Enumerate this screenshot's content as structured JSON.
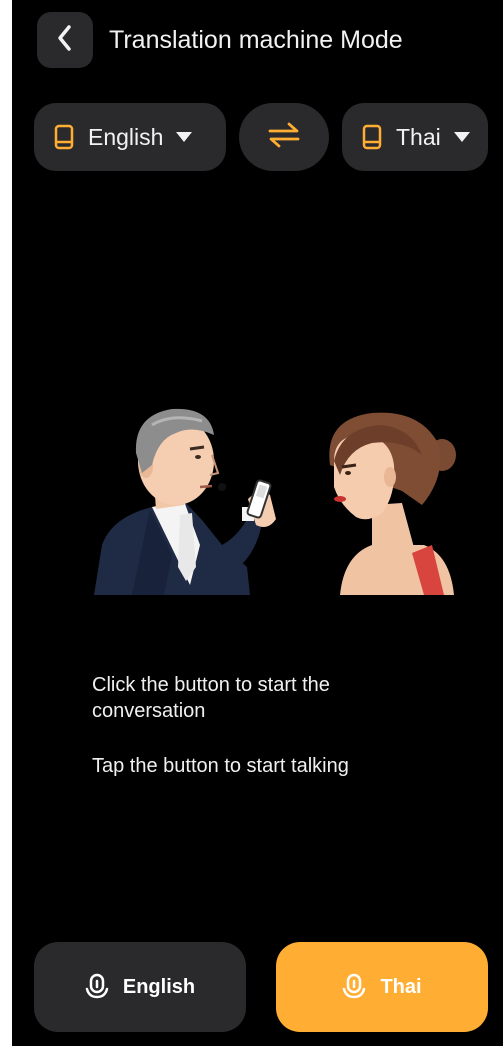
{
  "colors": {
    "background": "#000000",
    "surface": "#2a2a2d",
    "accent": "#ffad33",
    "text": "#f2f2f2"
  },
  "header": {
    "back_icon": "chevron-left-icon",
    "title": "Translation machine Mode"
  },
  "language_bar": {
    "source": {
      "icon": "phone-icon",
      "label": "English",
      "dropdown_icon": "caret-down-icon"
    },
    "swap_icon": "swap-arrows-icon",
    "target": {
      "icon": "phone-icon",
      "label": "Thai",
      "dropdown_icon": "caret-down-icon"
    }
  },
  "illustration": {
    "description_icon": "conversation-illustration"
  },
  "instructions": {
    "line1": "Click the button to start the conversation",
    "line2": "Tap the button to start talking"
  },
  "mic_buttons": {
    "left": {
      "icon": "microphone-icon",
      "label": "English"
    },
    "right": {
      "icon": "microphone-icon",
      "label": "Thai"
    }
  }
}
